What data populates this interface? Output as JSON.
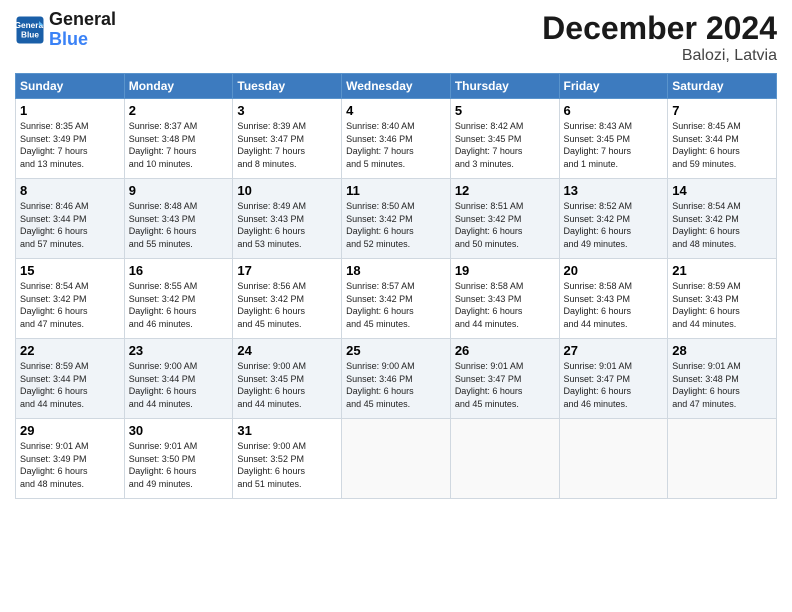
{
  "header": {
    "logo_line1": "General",
    "logo_line2": "Blue",
    "title": "December 2024",
    "subtitle": "Balozi, Latvia"
  },
  "days_of_week": [
    "Sunday",
    "Monday",
    "Tuesday",
    "Wednesday",
    "Thursday",
    "Friday",
    "Saturday"
  ],
  "weeks": [
    [
      {
        "day": "1",
        "info": "Sunrise: 8:35 AM\nSunset: 3:49 PM\nDaylight: 7 hours\nand 13 minutes."
      },
      {
        "day": "2",
        "info": "Sunrise: 8:37 AM\nSunset: 3:48 PM\nDaylight: 7 hours\nand 10 minutes."
      },
      {
        "day": "3",
        "info": "Sunrise: 8:39 AM\nSunset: 3:47 PM\nDaylight: 7 hours\nand 8 minutes."
      },
      {
        "day": "4",
        "info": "Sunrise: 8:40 AM\nSunset: 3:46 PM\nDaylight: 7 hours\nand 5 minutes."
      },
      {
        "day": "5",
        "info": "Sunrise: 8:42 AM\nSunset: 3:45 PM\nDaylight: 7 hours\nand 3 minutes."
      },
      {
        "day": "6",
        "info": "Sunrise: 8:43 AM\nSunset: 3:45 PM\nDaylight: 7 hours\nand 1 minute."
      },
      {
        "day": "7",
        "info": "Sunrise: 8:45 AM\nSunset: 3:44 PM\nDaylight: 6 hours\nand 59 minutes."
      }
    ],
    [
      {
        "day": "8",
        "info": "Sunrise: 8:46 AM\nSunset: 3:44 PM\nDaylight: 6 hours\nand 57 minutes."
      },
      {
        "day": "9",
        "info": "Sunrise: 8:48 AM\nSunset: 3:43 PM\nDaylight: 6 hours\nand 55 minutes."
      },
      {
        "day": "10",
        "info": "Sunrise: 8:49 AM\nSunset: 3:43 PM\nDaylight: 6 hours\nand 53 minutes."
      },
      {
        "day": "11",
        "info": "Sunrise: 8:50 AM\nSunset: 3:42 PM\nDaylight: 6 hours\nand 52 minutes."
      },
      {
        "day": "12",
        "info": "Sunrise: 8:51 AM\nSunset: 3:42 PM\nDaylight: 6 hours\nand 50 minutes."
      },
      {
        "day": "13",
        "info": "Sunrise: 8:52 AM\nSunset: 3:42 PM\nDaylight: 6 hours\nand 49 minutes."
      },
      {
        "day": "14",
        "info": "Sunrise: 8:54 AM\nSunset: 3:42 PM\nDaylight: 6 hours\nand 48 minutes."
      }
    ],
    [
      {
        "day": "15",
        "info": "Sunrise: 8:54 AM\nSunset: 3:42 PM\nDaylight: 6 hours\nand 47 minutes."
      },
      {
        "day": "16",
        "info": "Sunrise: 8:55 AM\nSunset: 3:42 PM\nDaylight: 6 hours\nand 46 minutes."
      },
      {
        "day": "17",
        "info": "Sunrise: 8:56 AM\nSunset: 3:42 PM\nDaylight: 6 hours\nand 45 minutes."
      },
      {
        "day": "18",
        "info": "Sunrise: 8:57 AM\nSunset: 3:42 PM\nDaylight: 6 hours\nand 45 minutes."
      },
      {
        "day": "19",
        "info": "Sunrise: 8:58 AM\nSunset: 3:43 PM\nDaylight: 6 hours\nand 44 minutes."
      },
      {
        "day": "20",
        "info": "Sunrise: 8:58 AM\nSunset: 3:43 PM\nDaylight: 6 hours\nand 44 minutes."
      },
      {
        "day": "21",
        "info": "Sunrise: 8:59 AM\nSunset: 3:43 PM\nDaylight: 6 hours\nand 44 minutes."
      }
    ],
    [
      {
        "day": "22",
        "info": "Sunrise: 8:59 AM\nSunset: 3:44 PM\nDaylight: 6 hours\nand 44 minutes."
      },
      {
        "day": "23",
        "info": "Sunrise: 9:00 AM\nSunset: 3:44 PM\nDaylight: 6 hours\nand 44 minutes."
      },
      {
        "day": "24",
        "info": "Sunrise: 9:00 AM\nSunset: 3:45 PM\nDaylight: 6 hours\nand 44 minutes."
      },
      {
        "day": "25",
        "info": "Sunrise: 9:00 AM\nSunset: 3:46 PM\nDaylight: 6 hours\nand 45 minutes."
      },
      {
        "day": "26",
        "info": "Sunrise: 9:01 AM\nSunset: 3:47 PM\nDaylight: 6 hours\nand 45 minutes."
      },
      {
        "day": "27",
        "info": "Sunrise: 9:01 AM\nSunset: 3:47 PM\nDaylight: 6 hours\nand 46 minutes."
      },
      {
        "day": "28",
        "info": "Sunrise: 9:01 AM\nSunset: 3:48 PM\nDaylight: 6 hours\nand 47 minutes."
      }
    ],
    [
      {
        "day": "29",
        "info": "Sunrise: 9:01 AM\nSunset: 3:49 PM\nDaylight: 6 hours\nand 48 minutes."
      },
      {
        "day": "30",
        "info": "Sunrise: 9:01 AM\nSunset: 3:50 PM\nDaylight: 6 hours\nand 49 minutes."
      },
      {
        "day": "31",
        "info": "Sunrise: 9:00 AM\nSunset: 3:52 PM\nDaylight: 6 hours\nand 51 minutes."
      },
      {
        "day": "",
        "info": ""
      },
      {
        "day": "",
        "info": ""
      },
      {
        "day": "",
        "info": ""
      },
      {
        "day": "",
        "info": ""
      }
    ]
  ]
}
